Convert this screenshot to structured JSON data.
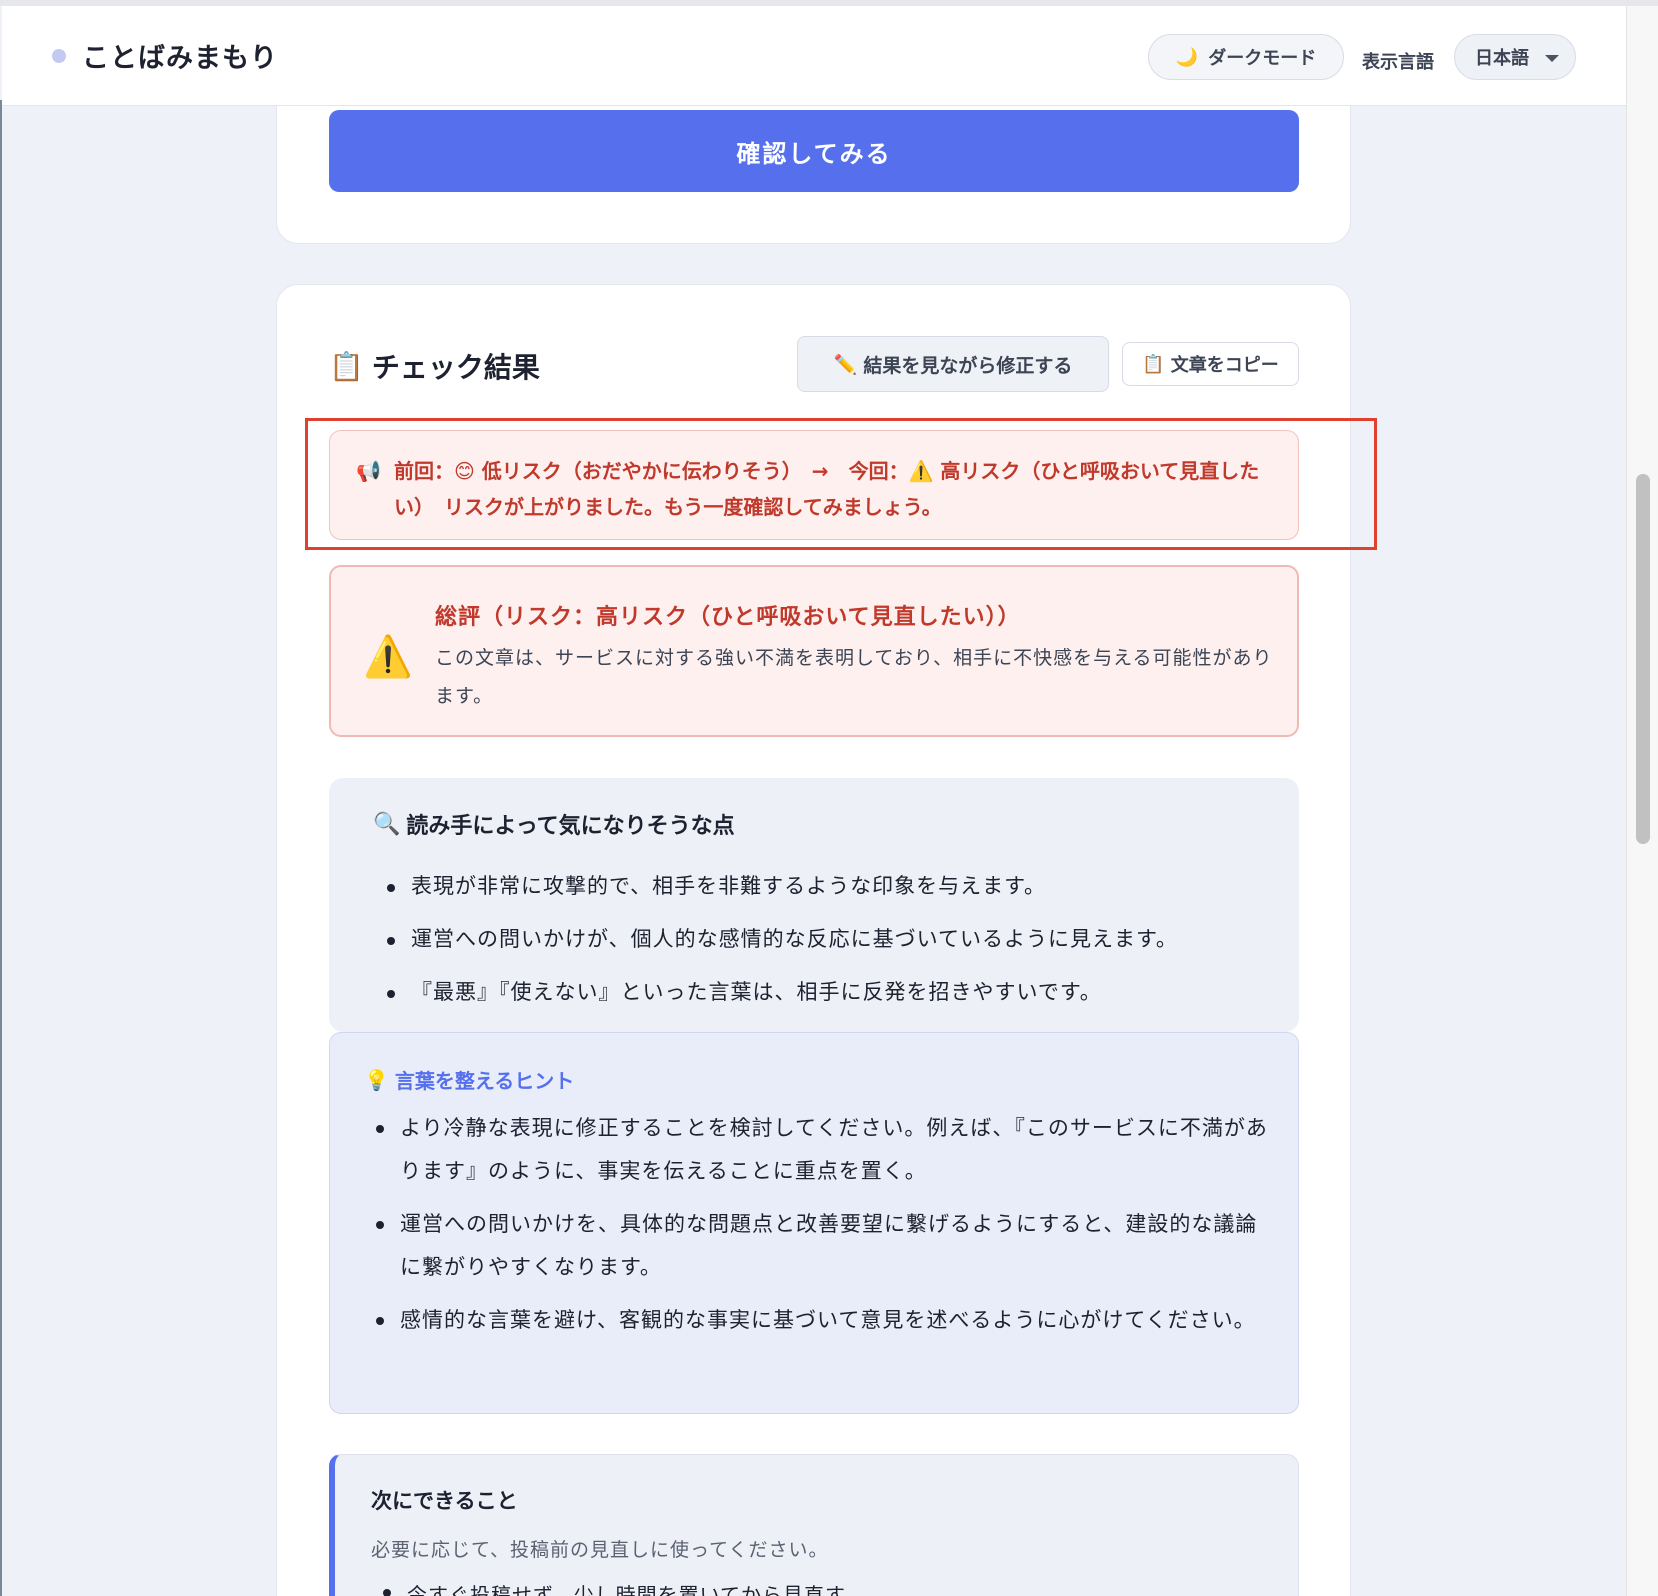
{
  "header": {
    "brand": "ことばみまもり",
    "dark_mode_label": "ダークモード",
    "dark_mode_icon": "🌙",
    "lang_label": "表示言語",
    "lang_selected": "日本語"
  },
  "form": {
    "confirm_label": "確認してみる"
  },
  "result": {
    "title_icon": "📋",
    "title": "チェック結果",
    "edit_icon": "✏️",
    "edit_label": "結果を見ながら修正する",
    "copy_icon": "📋",
    "copy_label": "文章をコピー",
    "comparison": {
      "icon": "📢",
      "text": "前回：😊 低リスク（おだやかに伝わりそう）　→　今回：⚠️ 高リスク（ひと呼吸おいて見直したい）　リスクが上がりました。もう一度確認してみましょう。"
    },
    "verdict": {
      "icon": "⚠️",
      "title": "総評（リスク：高リスク（ひと呼吸おいて見直したい））",
      "body": "この文章は、サービスに対する強い不満を表明しており、相手に不快感を与える可能性があります。"
    },
    "concerns": {
      "icon": "🔍",
      "title": "読み手によって気になりそうな点",
      "items": [
        "表現が非常に攻撃的で、相手を非難するような印象を与えます。",
        "運営への問いかけが、個人的な感情的な反応に基づいているように見えます。",
        "『最悪』『使えない』といった言葉は、相手に反発を招きやすいです。"
      ]
    },
    "hints": {
      "icon": "💡",
      "title": "言葉を整えるヒント",
      "items": [
        "より冷静な表現に修正することを検討してください。例えば、『このサービスに不満があります』のように、事実を伝えることに重点を置く。",
        "運営への問いかけを、具体的な問題点と改善要望に繋げるようにすると、建設的な議論に繋がりやすくなります。",
        "感情的な言葉を避け、客観的な事実に基づいて意見を述べるように心がけてください。"
      ]
    },
    "next": {
      "title": "次にできること",
      "description": "必要に応じて、投稿前の見直しに使ってください。",
      "first_item": "今すぐ投稿せず、少し時間を置いてから見直す"
    }
  },
  "colors": {
    "accent": "#5670ed",
    "danger": "#c0392b",
    "highlight": "#e0402e"
  }
}
